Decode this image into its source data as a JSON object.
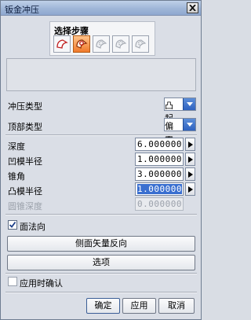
{
  "window": {
    "title": "钣金冲压",
    "close_icon": "close-icon"
  },
  "steps": {
    "label": "选择步骤",
    "buttons": [
      {
        "name": "step-face-button",
        "icon": "sheet-face-icon",
        "active": false,
        "enabled": true
      },
      {
        "name": "step-curve-button",
        "icon": "punch-curve-icon",
        "active": true,
        "enabled": true
      },
      {
        "name": "step-3-button",
        "icon": "punch-gear-icon",
        "active": false,
        "enabled": false
      },
      {
        "name": "step-4-button",
        "icon": "punch-gear-icon",
        "active": false,
        "enabled": false
      },
      {
        "name": "step-5-button",
        "icon": "punch-gear-icon",
        "active": false,
        "enabled": false
      }
    ]
  },
  "form": {
    "punch_type_label": "冲压类型",
    "punch_type_value": "凸起",
    "top_type_label": "顶部类型",
    "top_type_value": "偏置",
    "depth_label": "深度",
    "depth_value": "6.000000",
    "die_radius_label": "凹模半径",
    "die_radius_value": "1.000000",
    "taper_label": "锥角",
    "taper_value": "3.000000",
    "punch_radius_label": "凸模半径",
    "punch_radius_value": "1.000000",
    "cone_depth_label": "圆锥深度",
    "cone_depth_value": "0.000000"
  },
  "face_normal": {
    "label": "面法向",
    "checked": true
  },
  "buttons": {
    "reverse_side_vector": "侧面矢量反向",
    "options": "选项",
    "confirm_on_apply": "应用时确认",
    "confirm_on_apply_checked": false,
    "ok": "确定",
    "apply": "应用",
    "cancel": "取消"
  },
  "colors": {
    "active_step": "#f07a2c",
    "combo_button": "#2e62c0",
    "selection": "#3a6fd0"
  }
}
